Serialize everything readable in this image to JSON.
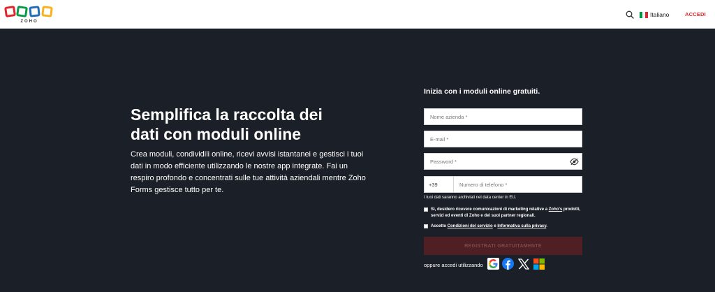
{
  "header": {
    "logo_text": "ZOHO",
    "language": "Italiano",
    "signin_label": "ACCEDI",
    "icons": [
      "search-icon",
      "italy-flag-icon"
    ]
  },
  "hero": {
    "title": "Semplifica la raccolta dei dati con moduli online",
    "description": "Crea moduli, condividili online, ricevi avvisi istantanei e gestisci i tuoi dati in modo efficiente utilizzando le nostre app integrate. Fai un respiro profondo e concentrati sulle tue attività aziendali mentre Zoho Forms gestisce tutto per te."
  },
  "form": {
    "title": "Inizia con i moduli online gratuiti.",
    "company_placeholder": "Nome azienda *",
    "email_placeholder": "E-mail *",
    "password_placeholder": "Password *",
    "phone_prefix": "+39",
    "phone_placeholder": "Numero di telefono *",
    "data_note": "I tuoi dati saranno archiviati nel data center in EU.",
    "marketing_consent": {
      "text_before": "Sì, desidero ricevere comunicazioni di marketing relative a ",
      "link": "Zoho's",
      "text_after": " prodotti, servizi ed eventi di Zoho e dei suoi partner regionali."
    },
    "terms_consent": {
      "prefix": "Accetto ",
      "terms_link": "Condizioni del servizio",
      "middle": " e ",
      "privacy_link": "Informativa sulla privacy",
      "suffix": "."
    },
    "submit_label": "REGISTRATI GRATUITAMENTE",
    "alt_signin_label": "oppure accedi utilizzando",
    "social_icons": [
      "google-icon",
      "facebook-icon",
      "x-icon",
      "microsoft-icon"
    ]
  },
  "colors": {
    "background": "#1b1f27",
    "brand_red": "#e42527",
    "submit_bg": "#4f1f23",
    "logo_red": "#e42527",
    "logo_green": "#089949",
    "logo_blue": "#226db4",
    "logo_yellow": "#f9b21d"
  }
}
